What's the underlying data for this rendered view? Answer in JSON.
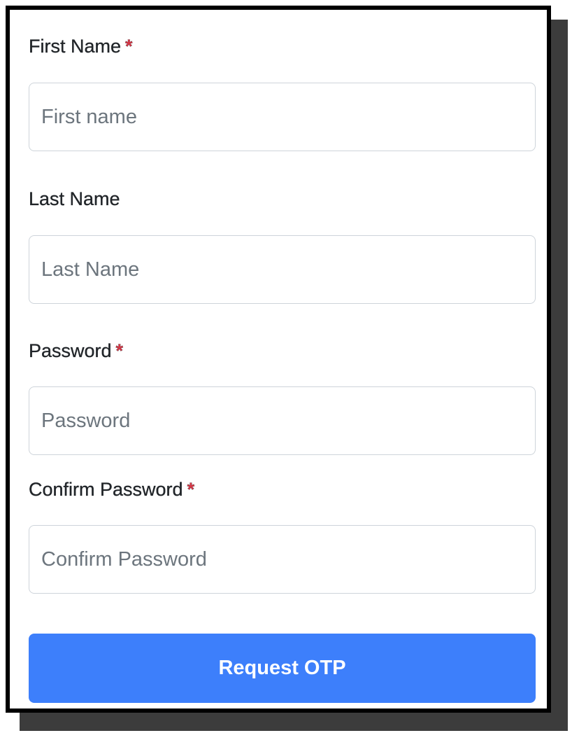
{
  "form": {
    "fields": [
      {
        "label": "First Name",
        "required_mark": "*",
        "placeholder": "First name",
        "value": ""
      },
      {
        "label": "Last Name",
        "required_mark": "",
        "placeholder": "Last Name",
        "value": ""
      },
      {
        "label": "Password",
        "required_mark": "*",
        "placeholder": "Password",
        "value": ""
      },
      {
        "label": "Confirm Password",
        "required_mark": "*",
        "placeholder": "Confirm Password",
        "value": ""
      }
    ],
    "submit_label": "Request OTP"
  },
  "colors": {
    "required": "#dc3545",
    "primary_button": "#3d7ffb",
    "input_border": "#ced4da",
    "placeholder": "#6c757d"
  }
}
